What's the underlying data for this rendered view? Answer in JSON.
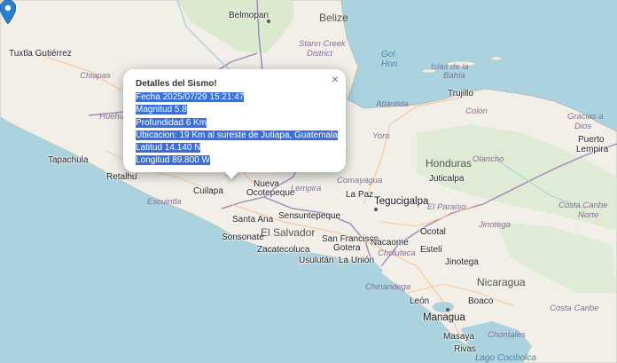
{
  "popup": {
    "title": "Detalles del Sismo!",
    "close_glyph": "×",
    "fecha": "Fecha 2025/07/29 15:21:47",
    "magnitud": "Magnitud 5.8",
    "profundidad": "Profundidad 6 Km",
    "ubicacion": "Ubicacion: 19 Km al sureste de Jutiapa, Guatemala",
    "latitud": "Latitud 14.140 N",
    "longitud": "Longitud 89.800 W",
    "trailing": "."
  },
  "marker": {
    "icon": "map-pin-icon",
    "color": "#2a81cb"
  },
  "labels": {
    "belmopan": "Belmopan",
    "belize": "Belize",
    "stann_creek": "Stann Creek",
    "district": "District",
    "tuxtla": "Tuxtla Gutiérrez",
    "chiapas": "Chiapas",
    "huehue": "Huehue",
    "tapachula": "Tapachula",
    "retalhuleu": "Retalhu",
    "escuintla": "Escuintla",
    "cuilapa": "Cuilapa",
    "nueva": "Nueva",
    "ocotepeque": "Ocotepeque",
    "santa_ana": "Santa Ana",
    "sonsonate": "Sonsonate",
    "el_salvador": "El Salvador",
    "sensuntepeque": "Sensuntepeque",
    "san_francisco": "San Francisco",
    "gotera": "Gotera",
    "zacatecoluca": "Zacatecoluca",
    "usulutan": "Usulután",
    "la_union": "La Unión",
    "lempira": "Lempira",
    "la_paz": "La Paz",
    "comayagua": "Comayagua",
    "tegucigalpa": "Tegucigalpa",
    "nacaome": "Nacaome",
    "choluteca": "Choluteca",
    "ocotal": "Ocotal",
    "yoro": "Yoro",
    "honduras": "Honduras",
    "atlantida": "Atlántida",
    "islas": "Islas de la",
    "bahia": "Bahía",
    "trujillo": "Trujillo",
    "colon": "Colón",
    "olancho": "Olancho",
    "juticalpa": "Juticalpa",
    "el_paraiso": "El Paraíso",
    "jinotega_region": "Jinotega",
    "jinotega": "Jinotega",
    "esteli": "Estelí",
    "nicaragua": "Nicaragua",
    "chinandega": "Chinandega",
    "leon": "León",
    "boaco": "Boaco",
    "managua": "Managua",
    "masaya": "Masaya",
    "chontales": "Chontales",
    "rivas": "Rivas",
    "puerto_lempira": "Puerto",
    "puerto_lempira2": "Lempira",
    "gracias": "Gracias a",
    "dios": "Dios",
    "costa_caribe_norte1": "Costa Caribe",
    "costa_caribe_norte2": "Norte",
    "costa_caribe_sur": "Costa Caribe",
    "lago_cocibolca": "Lago Cocibolca",
    "gol": "Gol",
    "gol2": "Hon"
  }
}
